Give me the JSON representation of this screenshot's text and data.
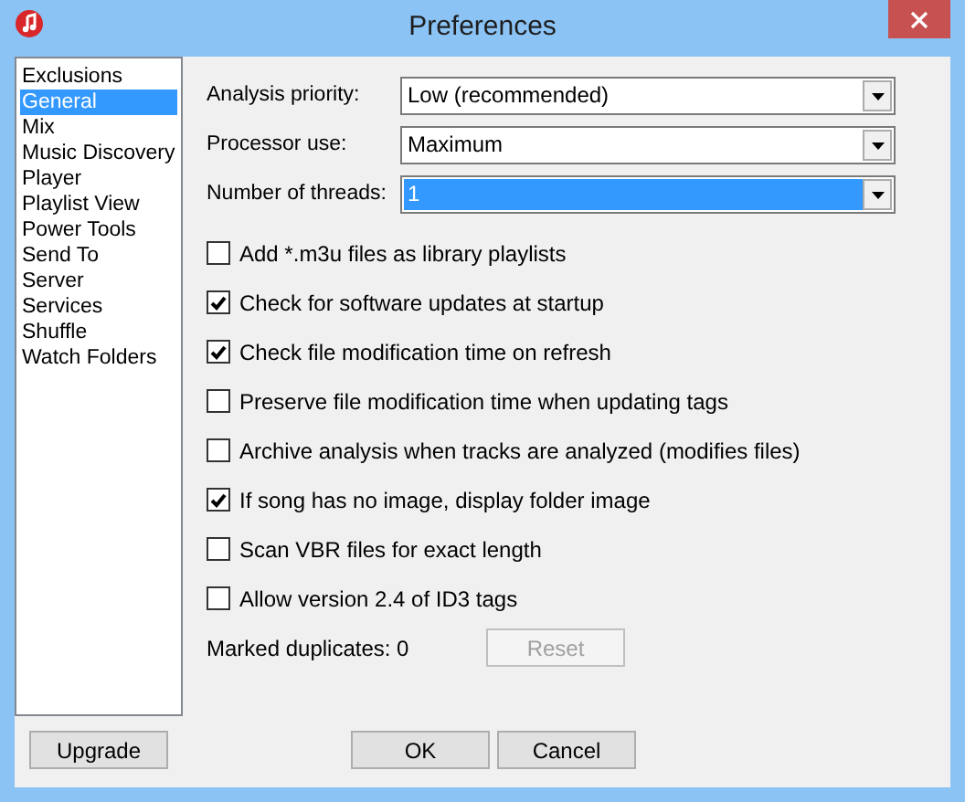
{
  "window": {
    "title": "Preferences"
  },
  "sidebar": {
    "items": [
      {
        "label": "Exclusions",
        "selected": false
      },
      {
        "label": "General",
        "selected": true
      },
      {
        "label": "Mix",
        "selected": false
      },
      {
        "label": "Music Discovery",
        "selected": false
      },
      {
        "label": "Player",
        "selected": false
      },
      {
        "label": "Playlist View",
        "selected": false
      },
      {
        "label": "Power Tools",
        "selected": false
      },
      {
        "label": "Send To",
        "selected": false
      },
      {
        "label": "Server",
        "selected": false
      },
      {
        "label": "Services",
        "selected": false
      },
      {
        "label": "Shuffle",
        "selected": false
      },
      {
        "label": "Watch Folders",
        "selected": false
      }
    ]
  },
  "dropdowns": [
    {
      "label": "Analysis priority:",
      "value": "Low (recommended)",
      "focused": false
    },
    {
      "label": "Processor use:",
      "value": "Maximum",
      "focused": false
    },
    {
      "label": "Number of threads:",
      "value": "1",
      "focused": true
    }
  ],
  "checkboxes": [
    {
      "label": "Add *.m3u files as library playlists",
      "checked": false
    },
    {
      "label": "Check for software updates at startup",
      "checked": true
    },
    {
      "label": "Check file modification time on refresh",
      "checked": true
    },
    {
      "label": "Preserve file modification time when updating tags",
      "checked": false
    },
    {
      "label": "Archive analysis when tracks are analyzed (modifies files)",
      "checked": false
    },
    {
      "label": "If song has no image, display folder image",
      "checked": true
    },
    {
      "label": "Scan VBR files for exact length",
      "checked": false
    },
    {
      "label": "Allow version 2.4 of ID3 tags",
      "checked": false
    }
  ],
  "marked_duplicates": {
    "label": "Marked duplicates: 0",
    "button": {
      "label": "Reset",
      "disabled": true
    }
  },
  "footer": {
    "left_button": "Upgrade",
    "buttons": [
      "OK",
      "Cancel"
    ]
  }
}
